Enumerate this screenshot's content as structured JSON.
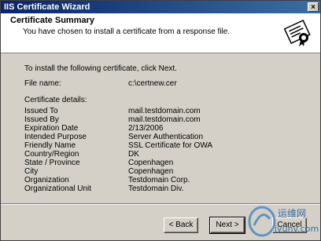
{
  "window": {
    "title": "IIS Certificate Wizard",
    "close_label": "×"
  },
  "header": {
    "title": "Certificate Summary",
    "subtitle": "You have chosen to install a certificate from a response file."
  },
  "body": {
    "intro": "To install the following certificate, click Next.",
    "file_label": "File name:",
    "file_value": "c:\\certnew.cer",
    "details_label": "Certificate details:",
    "details": [
      {
        "key": "Issued To",
        "value": "mail.testdomain.com"
      },
      {
        "key": "Issued By",
        "value": "mail.testdomain.com"
      },
      {
        "key": "Expiration Date",
        "value": "2/13/2006"
      },
      {
        "key": "Intended Purpose",
        "value": "Server Authentication"
      },
      {
        "key": "Friendly Name",
        "value": "SSL Certificate for OWA"
      },
      {
        "key": "Country/Region",
        "value": "DK"
      },
      {
        "key": "State / Province",
        "value": "Copenhagen"
      },
      {
        "key": "City",
        "value": "Copenhagen"
      },
      {
        "key": "Organization",
        "value": "Testdomain Corp."
      },
      {
        "key": "Organizational Unit",
        "value": "Testdomain Div."
      }
    ]
  },
  "buttons": {
    "back": "< Back",
    "next": "Next >",
    "cancel": "Cancel"
  },
  "watermark": {
    "line1": "运维网",
    "line2": "iyunv.com"
  },
  "colors": {
    "titlebar": "#0a246a",
    "face": "#d4d0c8"
  }
}
